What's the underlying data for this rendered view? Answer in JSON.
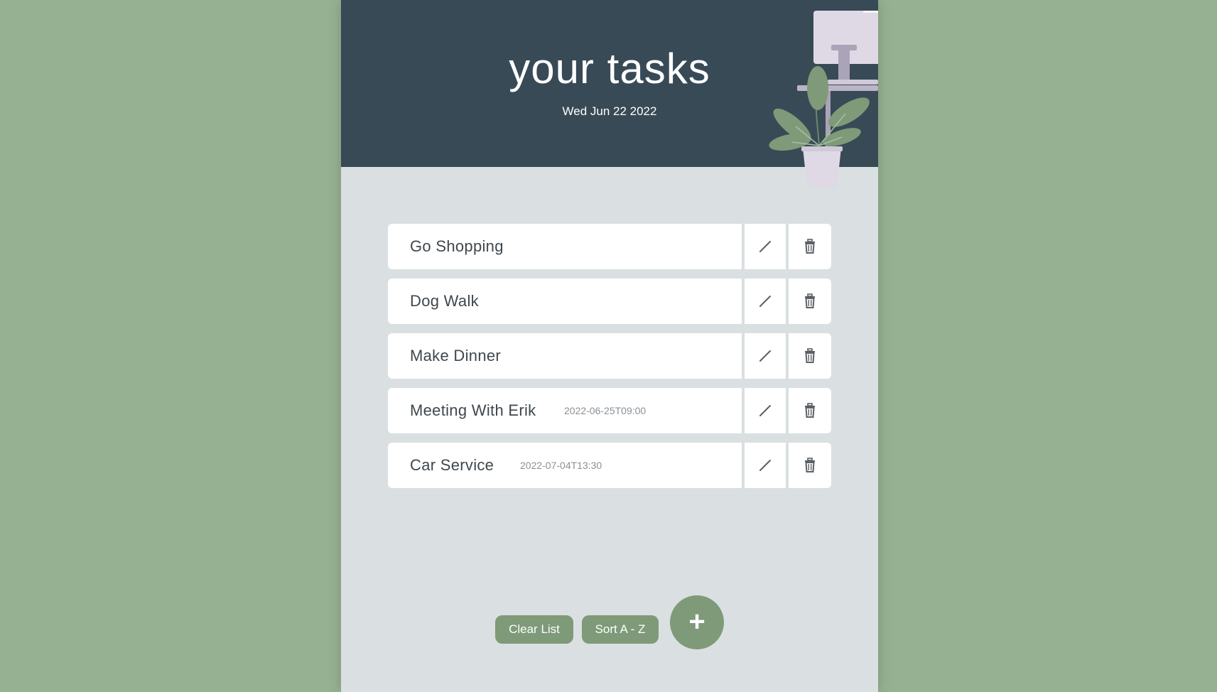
{
  "header": {
    "title": "your tasks",
    "date": "Wed Jun 22 2022"
  },
  "tasks": [
    {
      "title": "Go Shopping",
      "datetime": ""
    },
    {
      "title": "Dog Walk",
      "datetime": ""
    },
    {
      "title": "Make Dinner",
      "datetime": ""
    },
    {
      "title": "Meeting With Erik",
      "datetime": "2022-06-25T09:00"
    },
    {
      "title": "Car Service",
      "datetime": "2022-07-04T13:30"
    }
  ],
  "icons": {
    "edit": "pencil-icon",
    "delete": "trash-icon",
    "add": "plus-icon"
  },
  "actions": {
    "clear_label": "Clear List",
    "sort_label": "Sort A - Z",
    "add_label": "+"
  },
  "colors": {
    "page_background": "#96b192",
    "header_background": "#384a56",
    "content_background": "#dadfe1",
    "accent": "#7e9a78"
  }
}
